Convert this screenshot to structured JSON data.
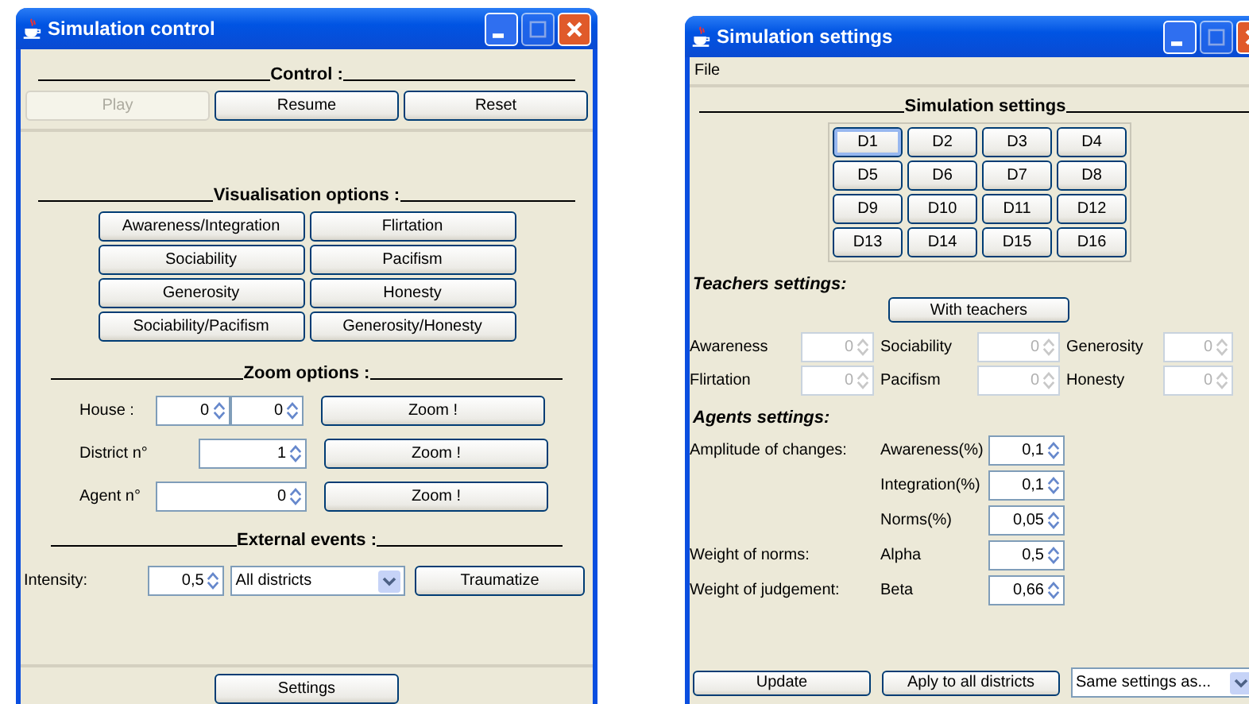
{
  "control_window": {
    "title": "Simulation control",
    "control": {
      "heading": "Control :",
      "buttons": [
        {
          "label": "Play",
          "disabled": true
        },
        {
          "label": "Resume",
          "disabled": false
        },
        {
          "label": "Reset",
          "disabled": false
        }
      ]
    },
    "visualisation": {
      "heading": "Visualisation options :",
      "buttons": [
        "Awareness/Integration",
        "Flirtation",
        "Sociability",
        "Pacifism",
        "Generosity",
        "Honesty",
        "Sociability/Pacifism",
        "Generosity/Honesty"
      ]
    },
    "zoom": {
      "heading": "Zoom options :",
      "rows": [
        {
          "label": "House :",
          "values": [
            "0",
            "0"
          ],
          "button": "Zoom !"
        },
        {
          "label": "District n°",
          "values": [
            "1"
          ],
          "button": "Zoom !"
        },
        {
          "label": "Agent n°",
          "values": [
            "0"
          ],
          "button": "Zoom !"
        }
      ]
    },
    "external_events": {
      "heading": "External events :",
      "label": "Intensity:",
      "intensity": "0,5",
      "target": "All districts",
      "button": "Traumatize"
    },
    "footer_button": "Settings"
  },
  "settings_window": {
    "title": "Simulation settings",
    "menu": [
      "File"
    ],
    "heading": "Simulation settings",
    "districts": [
      {
        "label": "D1",
        "selected": true
      },
      {
        "label": "D2",
        "selected": false
      },
      {
        "label": "D3",
        "selected": false
      },
      {
        "label": "D4",
        "selected": false
      },
      {
        "label": "D5",
        "selected": false
      },
      {
        "label": "D6",
        "selected": false
      },
      {
        "label": "D7",
        "selected": false
      },
      {
        "label": "D8",
        "selected": false
      },
      {
        "label": "D9",
        "selected": false
      },
      {
        "label": "D10",
        "selected": false
      },
      {
        "label": "D11",
        "selected": false
      },
      {
        "label": "D12",
        "selected": false
      },
      {
        "label": "D13",
        "selected": false
      },
      {
        "label": "D14",
        "selected": false
      },
      {
        "label": "D15",
        "selected": false
      },
      {
        "label": "D16",
        "selected": false
      }
    ],
    "teachers": {
      "heading": "Teachers settings:",
      "button": "With teachers",
      "fields": [
        {
          "label": "Awareness",
          "value": "0",
          "disabled": true
        },
        {
          "label": "Sociability",
          "value": "0",
          "disabled": true
        },
        {
          "label": "Generosity",
          "value": "0",
          "disabled": true
        },
        {
          "label": "Flirtation",
          "value": "0",
          "disabled": true
        },
        {
          "label": "Pacifism",
          "value": "0",
          "disabled": true
        },
        {
          "label": "Honesty",
          "value": "0",
          "disabled": true
        }
      ]
    },
    "agents": {
      "heading": "Agents settings:",
      "rows": [
        {
          "label": "Amplitude of changes:",
          "sublabel": "Awareness(%)",
          "value": "0,1"
        },
        {
          "sublabel": "Integration(%)",
          "value": "0,1"
        },
        {
          "sublabel": "Norms(%)",
          "value": "0,05"
        },
        {
          "label": "Weight of norms:",
          "sublabel": "Alpha",
          "value": "0,5"
        },
        {
          "label": "Weight of judgement:",
          "sublabel": "Beta",
          "value": "0,66"
        }
      ]
    },
    "buttons": [
      "Update",
      "Aply to all districts"
    ],
    "copy_from": "Same settings as..."
  }
}
